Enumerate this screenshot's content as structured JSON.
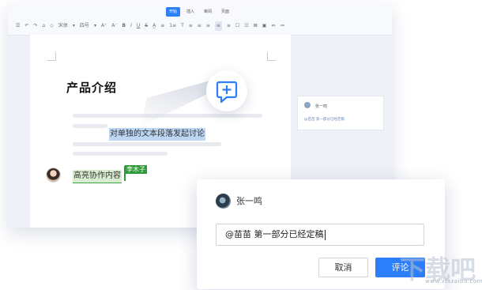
{
  "toolbar": {
    "tabs": [
      {
        "label": "开始",
        "active": true
      },
      {
        "label": "插入",
        "active": false
      },
      {
        "label": "审阅",
        "active": false
      },
      {
        "label": "页面",
        "active": false
      }
    ],
    "font_family": "宋体",
    "font_size": "四号",
    "items": [
      "A⁺",
      "A⁻",
      "B",
      "I",
      "U",
      "S",
      "A̲",
      "≡",
      "1≡",
      "T",
      "≡",
      "≡",
      "≡",
      "≡",
      "≡",
      "☐",
      "☷",
      "⊠",
      "▣",
      "⇔",
      "≔"
    ]
  },
  "document": {
    "title": "产品介绍",
    "highlight_sentence": "对单独的文本段落发起讨论",
    "collab_text": "高亮协作内容",
    "collaborator_tag": "李木子"
  },
  "side_comment": {
    "author": "张一鸣",
    "text": "@苗苗 第一部分已经定稿"
  },
  "comment_dialog": {
    "author": "张一鸣",
    "input_value": "@苗苗 第一部分已经定稿",
    "cancel_label": "取消",
    "submit_label": "评论"
  },
  "watermark": {
    "text": "下载吧",
    "url": "www.xiazaiba.com"
  },
  "colors": {
    "accent": "#2d7ff9",
    "selection": "#bcd6f4",
    "collab": "#2e9a3a",
    "collab_highlight": "#d9ecd0"
  }
}
